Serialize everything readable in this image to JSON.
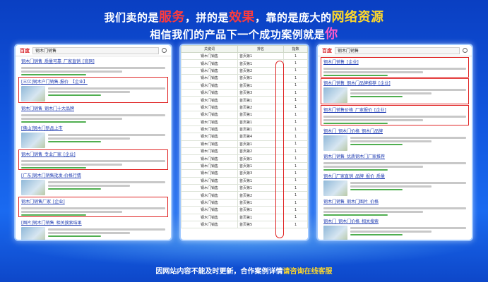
{
  "headline": {
    "line1_a": "我们卖的是",
    "line1_b": "服务",
    "line1_c": "，拼的是",
    "line1_d": "效果",
    "line1_e": "，靠的是庞大的",
    "line1_f": "网络资源",
    "line2_a": "相信我们的产品下一个成功案例就是",
    "line2_b": "你"
  },
  "left_panel": {
    "brand": "百度",
    "query": "钢木门销售",
    "results": [
      {
        "title": "钢木门销售_质量可靠_厂家直销_[官网]"
      },
      {
        "title": "[三亿]钢木户门销售-报价_【企业】",
        "boxed": true
      },
      {
        "title": "钢木门销售_钢木门十大品牌"
      },
      {
        "title": "[佛山]钢木门新品上市"
      },
      {
        "title": "钢木门销售_专业厂家_[企业]",
        "boxed": true
      },
      {
        "title": "[广东]钢木门销售批发-价格行情"
      },
      {
        "title": "钢木门销售厂家_[企业]",
        "boxed": true
      },
      {
        "title": "[图片]钢木门销售_相关搜索结果"
      }
    ]
  },
  "mid_panel": {
    "col1": "关键词",
    "col2": "排名",
    "col3": "指数",
    "rows": [
      {
        "k": "钢木门销售",
        "r": "首页第1",
        "n": "1"
      },
      {
        "k": "钢木门销售",
        "r": "首页第1",
        "n": "1"
      },
      {
        "k": "钢木门销售",
        "r": "首页第2",
        "n": "1"
      },
      {
        "k": "钢木门销售",
        "r": "首页第1",
        "n": "1"
      },
      {
        "k": "钢木门销售",
        "r": "首页第1",
        "n": "1"
      },
      {
        "k": "钢木门销售",
        "r": "首页第3",
        "n": "1"
      },
      {
        "k": "钢木门销售",
        "r": "首页第1",
        "n": "1"
      },
      {
        "k": "钢木门销售",
        "r": "首页第2",
        "n": "1"
      },
      {
        "k": "钢木门销售",
        "r": "首页第1",
        "n": "1"
      },
      {
        "k": "钢木门销售",
        "r": "首页第1",
        "n": "1"
      },
      {
        "k": "钢木门销售",
        "r": "首页第1",
        "n": "1"
      },
      {
        "k": "钢木门销售",
        "r": "首页第4",
        "n": "1"
      },
      {
        "k": "钢木门销售",
        "r": "首页第1",
        "n": "1"
      },
      {
        "k": "钢木门销售",
        "r": "首页第2",
        "n": "1"
      },
      {
        "k": "钢木门销售",
        "r": "首页第1",
        "n": "1"
      },
      {
        "k": "钢木门销售",
        "r": "首页第1",
        "n": "1"
      },
      {
        "k": "钢木门销售",
        "r": "首页第3",
        "n": "1"
      },
      {
        "k": "钢木门销售",
        "r": "首页第1",
        "n": "1"
      },
      {
        "k": "钢木门销售",
        "r": "首页第1",
        "n": "1"
      },
      {
        "k": "钢木门销售",
        "r": "首页第2",
        "n": "1"
      },
      {
        "k": "钢木门销售",
        "r": "首页第1",
        "n": "1"
      },
      {
        "k": "钢木门销售",
        "r": "首页第1",
        "n": "1"
      },
      {
        "k": "钢木门销售",
        "r": "首页第1",
        "n": "1"
      },
      {
        "k": "钢木门销售",
        "r": "首页第5",
        "n": "1"
      }
    ]
  },
  "right_panel": {
    "brand": "百度",
    "query": "钢木门销售",
    "results": [
      {
        "title": "钢木门销售_[企业]",
        "boxed": true
      },
      {
        "title": "钢木门销售_钢木门品牌推荐_[企业]",
        "boxed": true
      },
      {
        "title": "钢木门销售价格_厂家报价_[企业]",
        "boxed": true
      },
      {
        "title": "钢木门_钢木门价格_钢木门品牌"
      },
      {
        "title": "钢木门销售_优质钢木门厂家推荐"
      },
      {
        "title": "钢木门厂家直销_品牌_报价_质量"
      },
      {
        "title": "钢木门销售_钢木门图片_价格"
      },
      {
        "title": "钢木门_钢木门价格_相关搜索"
      }
    ]
  },
  "footer": {
    "text": "因网站内容不能及时更新，合作案例详情",
    "highlight": "请咨询在线客服"
  }
}
